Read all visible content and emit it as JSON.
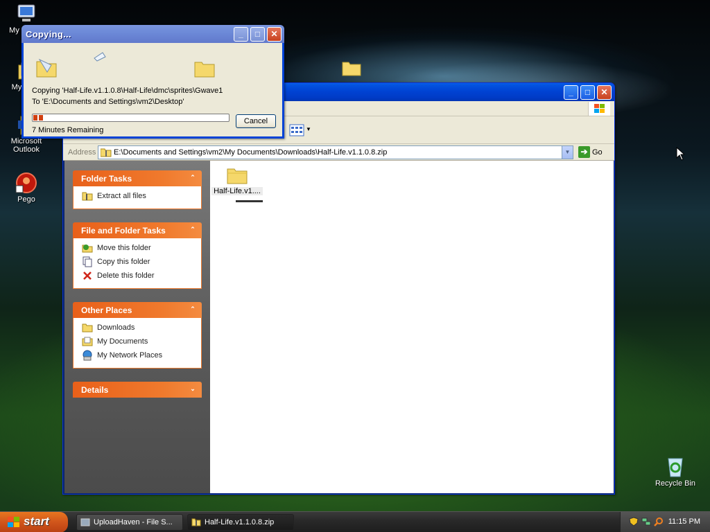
{
  "desktop": {
    "icons": [
      {
        "label": "My C"
      },
      {
        "label": "My"
      },
      {
        "label": "Microsoft Outlook"
      },
      {
        "label": "Pego"
      },
      {
        "label": "Recycle Bin"
      }
    ]
  },
  "copy_dialog": {
    "title": "Copying...",
    "line1": "Copying 'Half-Life.v1.1.0.8\\Half-Life\\dmc\\sprites\\Gwave1",
    "line2": "To 'E:\\Documents and Settings\\vm2\\Desktop'",
    "progress_fraction": 0.05,
    "remaining": "7 Minutes Remaining",
    "cancel_label": "Cancel"
  },
  "explorer": {
    "address_label": "Address",
    "address_value": "E:\\Documents and Settings\\vm2\\My Documents\\Downloads\\Half-Life.v1.1.0.8.zip",
    "go_label": "Go",
    "panels": {
      "folder_tasks": {
        "title": "Folder Tasks",
        "items": [
          "Extract all files"
        ]
      },
      "file_folder_tasks": {
        "title": "File and Folder Tasks",
        "items": [
          "Move this folder",
          "Copy this folder",
          "Delete this folder"
        ]
      },
      "other_places": {
        "title": "Other Places",
        "items": [
          "Downloads",
          "My Documents",
          "My Network Places"
        ]
      },
      "details": {
        "title": "Details"
      }
    },
    "content_items": [
      {
        "label": "Half-Life.v1...."
      }
    ]
  },
  "taskbar": {
    "start_label": "start",
    "tasks": [
      {
        "label": "UploadHaven - File S..."
      },
      {
        "label": "Half-Life.v1.1.0.8.zip"
      }
    ],
    "clock": "11:15 PM"
  },
  "colors": {
    "xp_blue": "#0043d3",
    "orange_panel": "#f07a2d",
    "start_orange": "#d0551b"
  }
}
